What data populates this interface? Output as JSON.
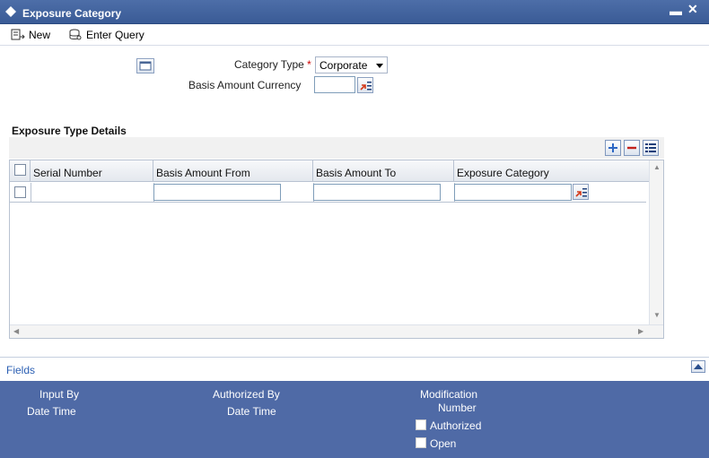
{
  "window": {
    "title": "Exposure Category"
  },
  "toolbar": {
    "new_label": "New",
    "enter_query_label": "Enter Query"
  },
  "form": {
    "category_type_label": "Category Type",
    "required_mark": "*",
    "category_type_value": "Corporate",
    "basis_amount_currency_label": "Basis Amount Currency",
    "basis_amount_currency_value": ""
  },
  "details": {
    "section_title": "Exposure Type Details",
    "columns": [
      "Serial Number",
      "Basis Amount From",
      "Basis Amount To",
      "Exposure Category"
    ],
    "rows": [
      {
        "serial_number": "",
        "basis_amount_from": "",
        "basis_amount_to": "",
        "exposure_category": ""
      }
    ]
  },
  "fields_bar": {
    "label": "Fields"
  },
  "footer": {
    "input_by_label": "Input By",
    "date_time_label_1": "Date Time",
    "authorized_by_label": "Authorized By",
    "date_time_label_2": "Date Time",
    "modification_label": "Modification",
    "number_label": "Number",
    "authorized_label": "Authorized",
    "open_label": "Open"
  }
}
